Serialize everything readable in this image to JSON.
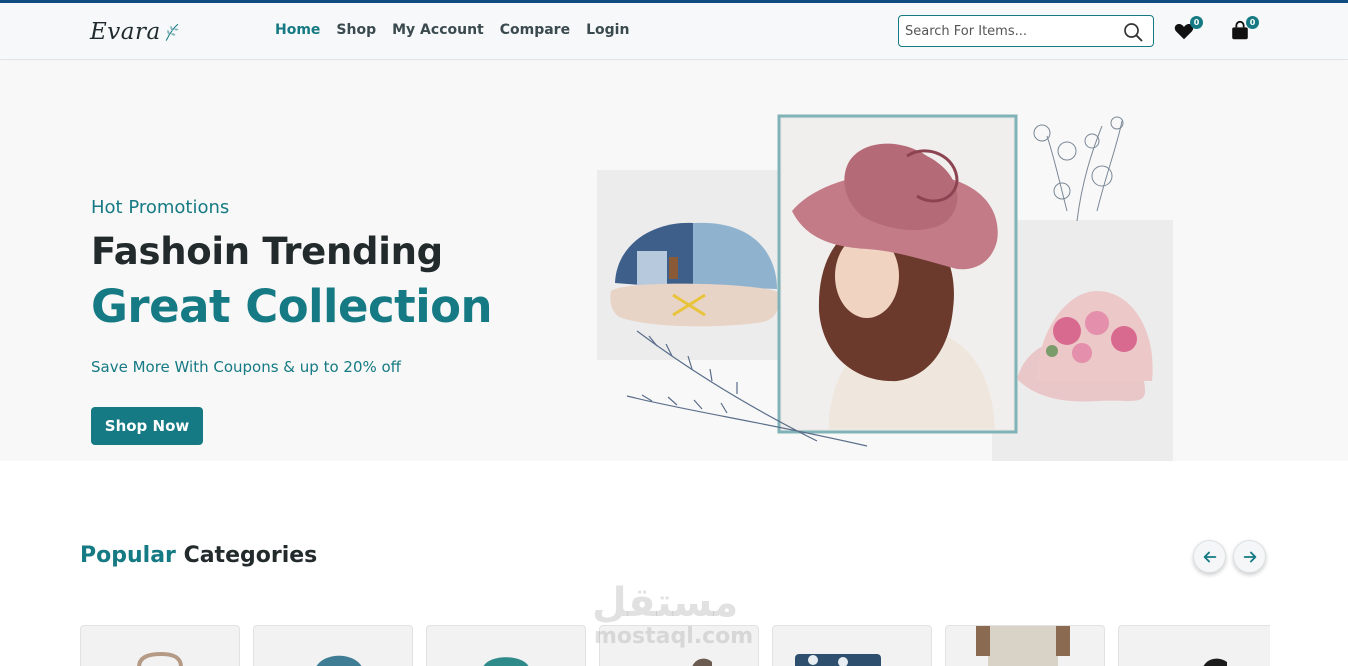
{
  "brand": {
    "logo_text": "Evara"
  },
  "nav": {
    "items": [
      {
        "label": "Home",
        "active": true
      },
      {
        "label": "Shop",
        "active": false
      },
      {
        "label": "My Account",
        "active": false
      },
      {
        "label": "Compare",
        "active": false
      },
      {
        "label": "Login",
        "active": false
      }
    ]
  },
  "search": {
    "placeholder": "Search For Items..."
  },
  "header_icons": {
    "wishlist": {
      "icon": "heart-icon",
      "count": "0"
    },
    "cart": {
      "icon": "shopping-bag-icon",
      "count": "0"
    }
  },
  "hero": {
    "tag": "Hot Promotions",
    "line1": "Fashoin Trending",
    "line2": "Great Collection",
    "subtitle": "Save More With Coupons & up to 20% off",
    "button": "Shop Now"
  },
  "categories": {
    "title_highlight": "Popular",
    "title_rest": "Categories",
    "prev_icon": "arrow-left-icon",
    "next_icon": "arrow-right-icon"
  },
  "watermark": {
    "arabic": "مستقل",
    "latin": "mostaql.com"
  },
  "colors": {
    "accent": "#157a83",
    "dark": "#232a2c",
    "topline": "#0f4c81"
  }
}
